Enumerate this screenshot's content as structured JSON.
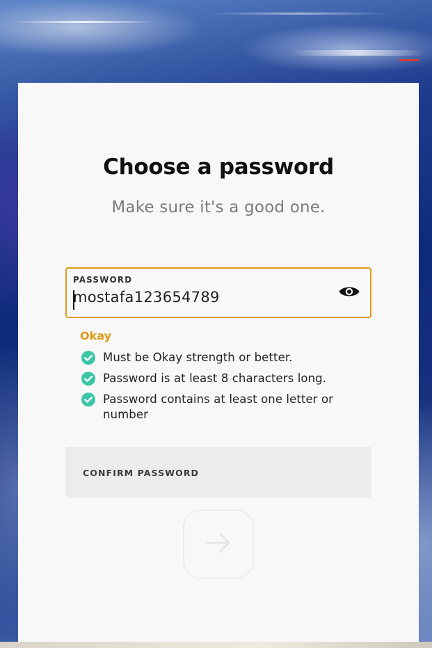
{
  "page": {
    "title": "Choose a password",
    "subtitle": "Make sure it's a good one."
  },
  "password_field": {
    "label": "PASSWORD",
    "value": "mostafa123654789",
    "reveal_icon": "eye-icon"
  },
  "strength": {
    "label": "Okay",
    "color": "#e09a16"
  },
  "requirements": [
    {
      "text": "Must be Okay strength or better.",
      "met": true
    },
    {
      "text": "Password is at least 8 characters long.",
      "met": true
    },
    {
      "text": "Password contains at least one letter or number",
      "met": true
    }
  ],
  "confirm_field": {
    "label": "CONFIRM PASSWORD",
    "value": ""
  },
  "next_button": {
    "icon": "arrow-right-icon",
    "enabled": false
  },
  "colors": {
    "accent": "#e09a16",
    "check": "#3cc6a8",
    "card": "#f8f8f8"
  }
}
